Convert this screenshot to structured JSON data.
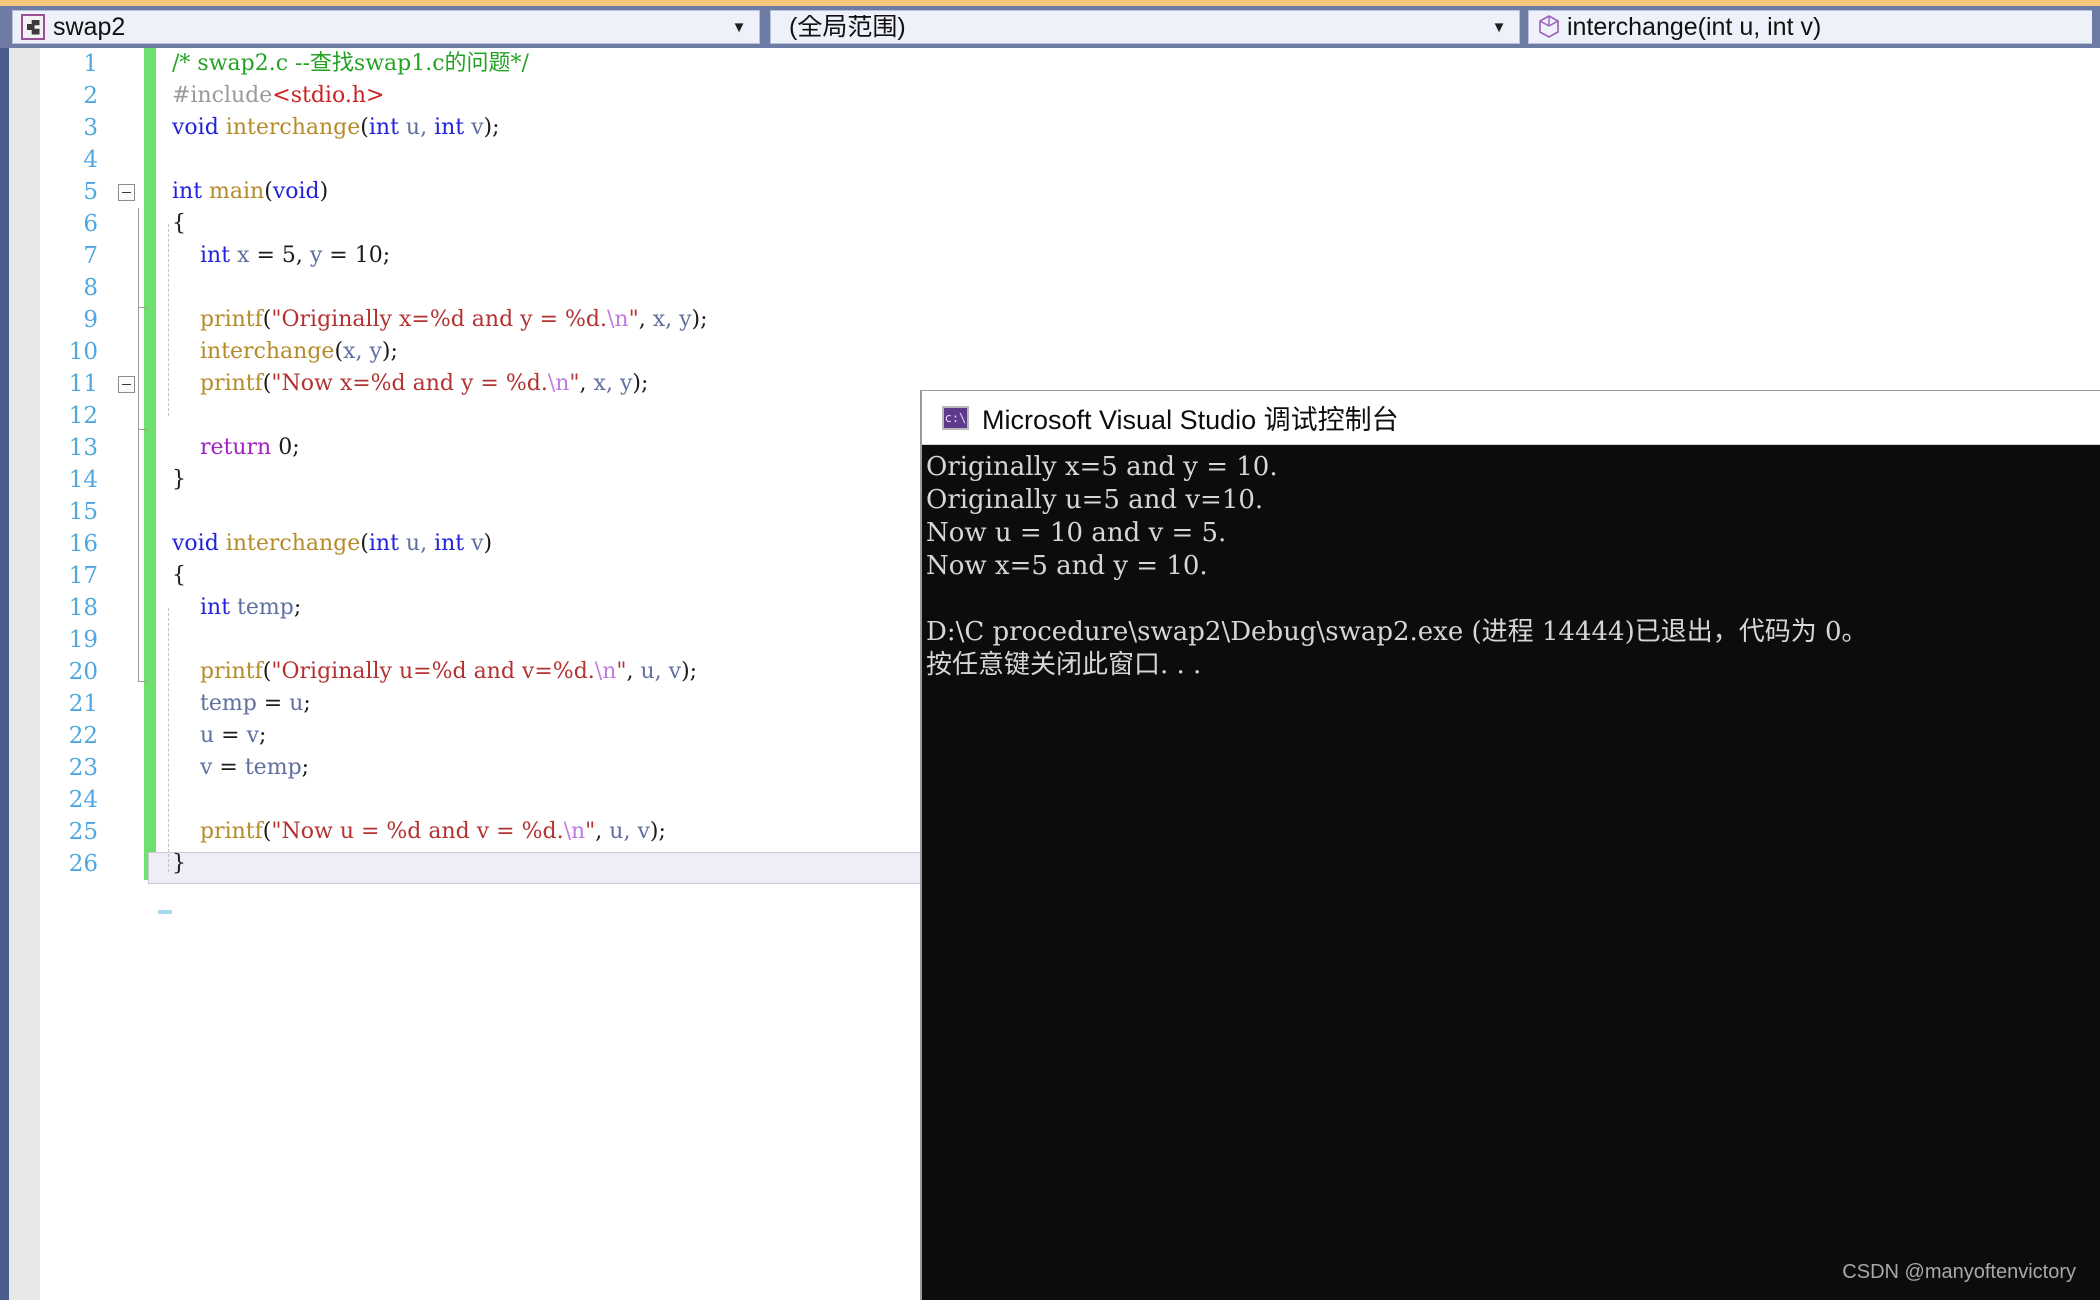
{
  "toolbar": {
    "project_combo": {
      "value": "swap2",
      "icon": "project-icon",
      "arrow": "▼"
    },
    "scope_combo": {
      "value": "(全局范围)",
      "arrow": "▼"
    },
    "member_combo": {
      "value": "interchange(int u, int v)",
      "icon": "cube-icon"
    }
  },
  "editor": {
    "language": "C",
    "lines": [
      {
        "n": "1",
        "tokens": [
          {
            "t": "/* swap2.c --查找swap1.c的问题*/",
            "c": "c-comment"
          }
        ]
      },
      {
        "n": "2",
        "tokens": [
          {
            "t": "#include",
            "c": "c-pre"
          },
          {
            "t": "<stdio.h>",
            "c": "c-inc"
          }
        ]
      },
      {
        "n": "3",
        "tokens": [
          {
            "t": "void",
            "c": "c-kw"
          },
          {
            "t": " ",
            "c": "c-punct"
          },
          {
            "t": "interchange",
            "c": "c-func"
          },
          {
            "t": "(",
            "c": "c-punct"
          },
          {
            "t": "int",
            "c": "c-kw"
          },
          {
            "t": " u, ",
            "c": "c-var"
          },
          {
            "t": "int",
            "c": "c-kw"
          },
          {
            "t": " v",
            "c": "c-var"
          },
          {
            "t": ");",
            "c": "c-punct"
          }
        ]
      },
      {
        "n": "4",
        "tokens": []
      },
      {
        "n": "5",
        "tokens": [
          {
            "t": "int",
            "c": "c-kw"
          },
          {
            "t": " ",
            "c": "c-punct"
          },
          {
            "t": "main",
            "c": "c-func"
          },
          {
            "t": "(",
            "c": "c-punct"
          },
          {
            "t": "void",
            "c": "c-kw"
          },
          {
            "t": ")",
            "c": "c-punct"
          }
        ]
      },
      {
        "n": "6",
        "tokens": [
          {
            "t": "{",
            "c": "c-punct"
          }
        ]
      },
      {
        "n": "7",
        "tokens": [
          {
            "t": "    ",
            "c": "c-punct"
          },
          {
            "t": "int",
            "c": "c-kw"
          },
          {
            "t": " x ",
            "c": "c-var"
          },
          {
            "t": "= ",
            "c": "c-punct"
          },
          {
            "t": "5",
            "c": "c-num"
          },
          {
            "t": ", ",
            "c": "c-punct"
          },
          {
            "t": "y ",
            "c": "c-var"
          },
          {
            "t": "= ",
            "c": "c-punct"
          },
          {
            "t": "10",
            "c": "c-num"
          },
          {
            "t": ";",
            "c": "c-punct"
          }
        ]
      },
      {
        "n": "8",
        "tokens": []
      },
      {
        "n": "9",
        "tokens": [
          {
            "t": "    ",
            "c": "c-punct"
          },
          {
            "t": "printf",
            "c": "c-func"
          },
          {
            "t": "(",
            "c": "c-punct"
          },
          {
            "t": "\"Originally x=%d and y = %d.",
            "c": "c-str"
          },
          {
            "t": "\\n",
            "c": "c-esc"
          },
          {
            "t": "\"",
            "c": "c-str"
          },
          {
            "t": ", ",
            "c": "c-punct"
          },
          {
            "t": "x, y",
            "c": "c-var"
          },
          {
            "t": ");",
            "c": "c-punct"
          }
        ]
      },
      {
        "n": "10",
        "tokens": [
          {
            "t": "    ",
            "c": "c-punct"
          },
          {
            "t": "interchange",
            "c": "c-func"
          },
          {
            "t": "(",
            "c": "c-punct"
          },
          {
            "t": "x, y",
            "c": "c-var"
          },
          {
            "t": ");",
            "c": "c-punct"
          }
        ]
      },
      {
        "n": "11",
        "tokens": [
          {
            "t": "    ",
            "c": "c-punct"
          },
          {
            "t": "printf",
            "c": "c-func"
          },
          {
            "t": "(",
            "c": "c-punct"
          },
          {
            "t": "\"Now x=%d and y = %d.",
            "c": "c-str"
          },
          {
            "t": "\\n",
            "c": "c-esc"
          },
          {
            "t": "\"",
            "c": "c-str"
          },
          {
            "t": ", ",
            "c": "c-punct"
          },
          {
            "t": "x, y",
            "c": "c-var"
          },
          {
            "t": ");",
            "c": "c-punct"
          }
        ]
      },
      {
        "n": "12",
        "tokens": []
      },
      {
        "n": "13",
        "tokens": [
          {
            "t": "    ",
            "c": "c-punct"
          },
          {
            "t": "return",
            "c": "c-ret"
          },
          {
            "t": " ",
            "c": "c-punct"
          },
          {
            "t": "0",
            "c": "c-num"
          },
          {
            "t": ";",
            "c": "c-punct"
          }
        ]
      },
      {
        "n": "14",
        "tokens": [
          {
            "t": "}",
            "c": "c-punct"
          }
        ]
      },
      {
        "n": "15",
        "tokens": []
      },
      {
        "n": "16",
        "tokens": [
          {
            "t": "void",
            "c": "c-kw"
          },
          {
            "t": " ",
            "c": "c-punct"
          },
          {
            "t": "interchange",
            "c": "c-func"
          },
          {
            "t": "(",
            "c": "c-punct"
          },
          {
            "t": "int",
            "c": "c-kw"
          },
          {
            "t": " u, ",
            "c": "c-var"
          },
          {
            "t": "int",
            "c": "c-kw"
          },
          {
            "t": " v",
            "c": "c-var"
          },
          {
            "t": ")",
            "c": "c-punct"
          }
        ]
      },
      {
        "n": "17",
        "tokens": [
          {
            "t": "{",
            "c": "c-punct"
          }
        ]
      },
      {
        "n": "18",
        "tokens": [
          {
            "t": "    ",
            "c": "c-punct"
          },
          {
            "t": "int",
            "c": "c-kw"
          },
          {
            "t": " temp",
            "c": "c-var"
          },
          {
            "t": ";",
            "c": "c-punct"
          }
        ]
      },
      {
        "n": "19",
        "tokens": []
      },
      {
        "n": "20",
        "tokens": [
          {
            "t": "    ",
            "c": "c-punct"
          },
          {
            "t": "printf",
            "c": "c-func"
          },
          {
            "t": "(",
            "c": "c-punct"
          },
          {
            "t": "\"Originally u=%d and v=%d.",
            "c": "c-str"
          },
          {
            "t": "\\n",
            "c": "c-esc"
          },
          {
            "t": "\"",
            "c": "c-str"
          },
          {
            "t": ", ",
            "c": "c-punct"
          },
          {
            "t": "u, v",
            "c": "c-var"
          },
          {
            "t": ");",
            "c": "c-punct"
          }
        ]
      },
      {
        "n": "21",
        "tokens": [
          {
            "t": "    ",
            "c": "c-punct"
          },
          {
            "t": "temp ",
            "c": "c-var"
          },
          {
            "t": "= ",
            "c": "c-punct"
          },
          {
            "t": "u",
            "c": "c-var"
          },
          {
            "t": ";",
            "c": "c-punct"
          }
        ]
      },
      {
        "n": "22",
        "tokens": [
          {
            "t": "    ",
            "c": "c-punct"
          },
          {
            "t": "u ",
            "c": "c-var"
          },
          {
            "t": "= ",
            "c": "c-punct"
          },
          {
            "t": "v",
            "c": "c-var"
          },
          {
            "t": ";",
            "c": "c-punct"
          }
        ]
      },
      {
        "n": "23",
        "tokens": [
          {
            "t": "    ",
            "c": "c-punct"
          },
          {
            "t": "v ",
            "c": "c-var"
          },
          {
            "t": "= ",
            "c": "c-punct"
          },
          {
            "t": "temp",
            "c": "c-var"
          },
          {
            "t": ";",
            "c": "c-punct"
          }
        ]
      },
      {
        "n": "24",
        "tokens": []
      },
      {
        "n": "25",
        "tokens": [
          {
            "t": "    ",
            "c": "c-punct"
          },
          {
            "t": "printf",
            "c": "c-func"
          },
          {
            "t": "(",
            "c": "c-punct"
          },
          {
            "t": "\"Now u = %d and v = %d.",
            "c": "c-str"
          },
          {
            "t": "\\n",
            "c": "c-esc"
          },
          {
            "t": "\"",
            "c": "c-str"
          },
          {
            "t": ", ",
            "c": "c-punct"
          },
          {
            "t": "u, v",
            "c": "c-var"
          },
          {
            "t": ");",
            "c": "c-punct"
          }
        ]
      },
      {
        "n": "26",
        "tokens": [
          {
            "t": "}",
            "c": "c-punct"
          }
        ]
      }
    ]
  },
  "console": {
    "title": "Microsoft Visual Studio 调试控制台",
    "icon": "console-cmd-icon",
    "output": [
      "Originally x=5 and y = 10.",
      "Originally u=5 and v=10.",
      "Now u = 10 and v = 5.",
      "Now x=5 and y = 10.",
      "",
      "D:\\C procedure\\swap2\\Debug\\swap2.exe (进程 14444)已退出，代码为 0。",
      "按任意键关闭此窗口. . ."
    ]
  },
  "watermark": "CSDN @manyoftenvictory"
}
